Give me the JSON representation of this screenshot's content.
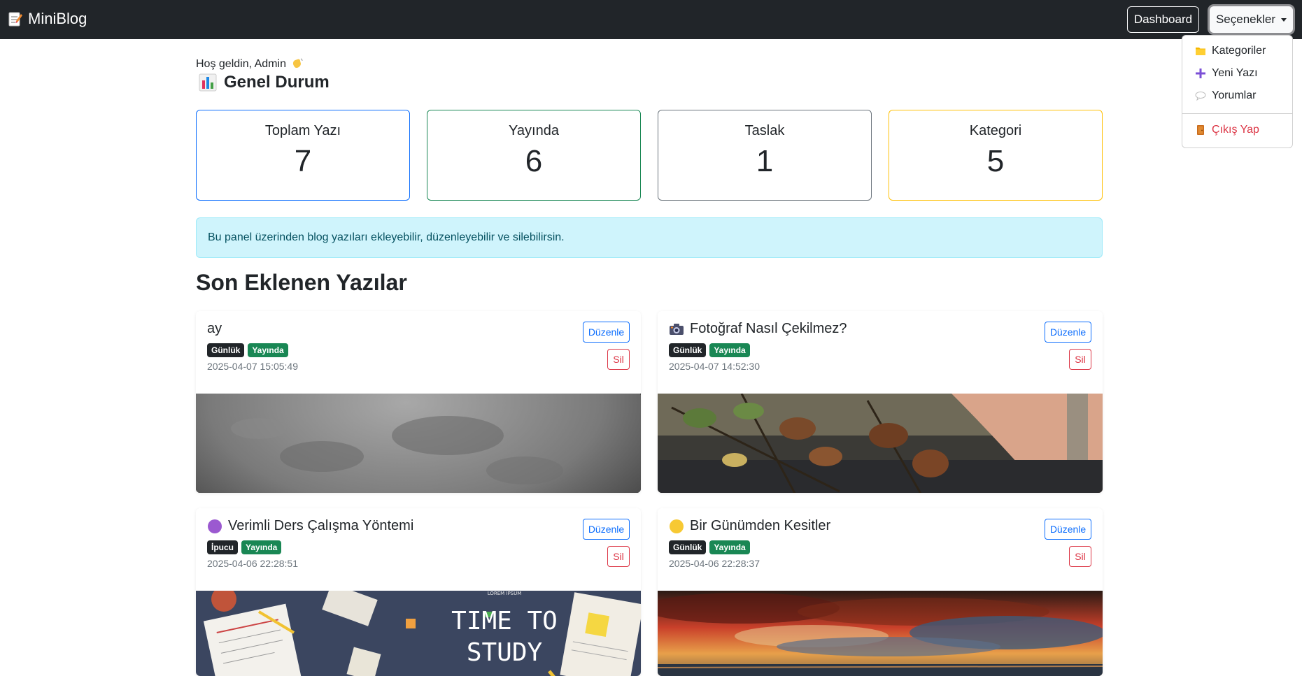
{
  "navbar": {
    "brand": "MiniBlog",
    "dashboard_label": "Dashboard",
    "options_label": "Seçenekler"
  },
  "dropdown": {
    "items": [
      {
        "label": "Kategoriler",
        "icon": "folder-icon"
      },
      {
        "label": "Yeni Yazı",
        "icon": "plus-icon"
      },
      {
        "label": "Yorumlar",
        "icon": "speech-bubble-icon"
      },
      {
        "label": "Çıkış Yap",
        "icon": "door-icon"
      }
    ]
  },
  "header": {
    "welcome": "Hoş geldin, Admin",
    "overview_title": "Genel Durum"
  },
  "stats": [
    {
      "label": "Toplam Yazı",
      "value": "7",
      "color": "#0d6efd"
    },
    {
      "label": "Yayında",
      "value": "6",
      "color": "#198754"
    },
    {
      "label": "Taslak",
      "value": "1",
      "color": "#6c757d"
    },
    {
      "label": "Kategori",
      "value": "5",
      "color": "#ffc107"
    }
  ],
  "alert": "Bu panel üzerinden blog yazıları ekleyebilir, düzenleyebilir ve silebilirsin.",
  "section_title": "Son Eklenen Yazılar",
  "posts": [
    {
      "title": "ay",
      "category": "Günlük",
      "status": "Yayında",
      "date": "2025-04-07 15:05:49",
      "edit": "Düzenle",
      "delete": "Sil"
    },
    {
      "title": "Fotoğraf Nasıl Çekilmez?",
      "category": "Günlük",
      "status": "Yayında",
      "date": "2025-04-07 14:52:30",
      "edit": "Düzenle",
      "delete": "Sil"
    },
    {
      "title": "Verimli Ders Çalışma Yöntemi",
      "category": "İpucu",
      "status": "Yayında",
      "date": "2025-04-06 22:28:51",
      "edit": "Düzenle",
      "delete": "Sil"
    },
    {
      "title": "Bir Günümden Kesitler",
      "category": "Günlük",
      "status": "Yayında",
      "date": "2025-04-06 22:28:37",
      "edit": "Düzenle",
      "delete": "Sil"
    }
  ],
  "study_image": {
    "small": "LOREM IPSUM",
    "line1": "TIME TO",
    "line2": "STUDY"
  }
}
